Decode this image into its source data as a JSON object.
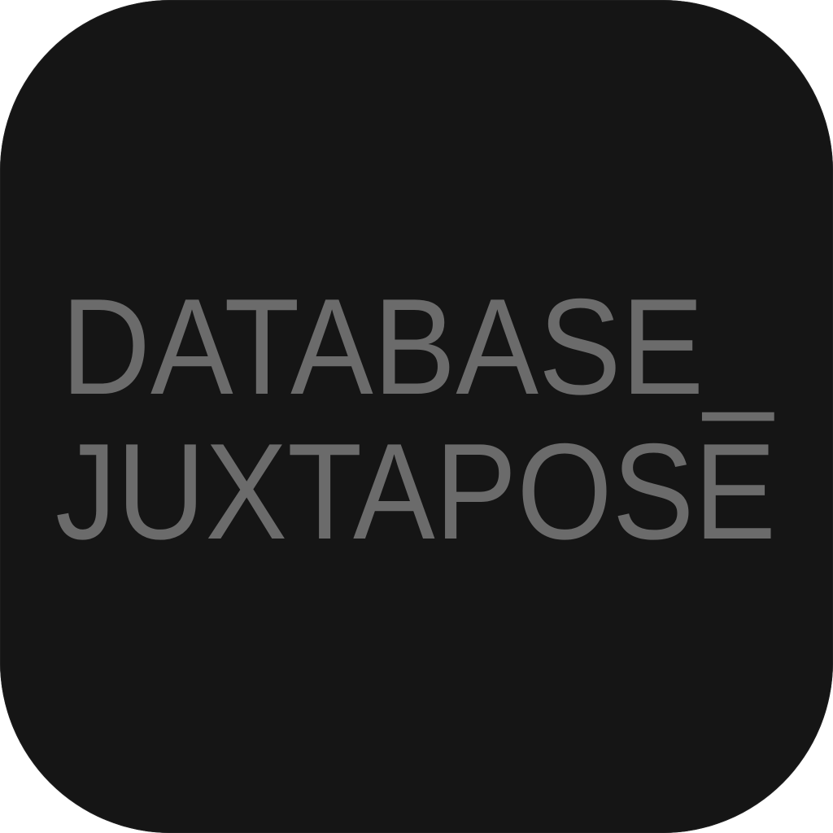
{
  "icon": {
    "line1": "DATABASE_",
    "line2": "JUXTAPOSE",
    "background_color": "#151515",
    "text_color": "#6b6b6b"
  }
}
